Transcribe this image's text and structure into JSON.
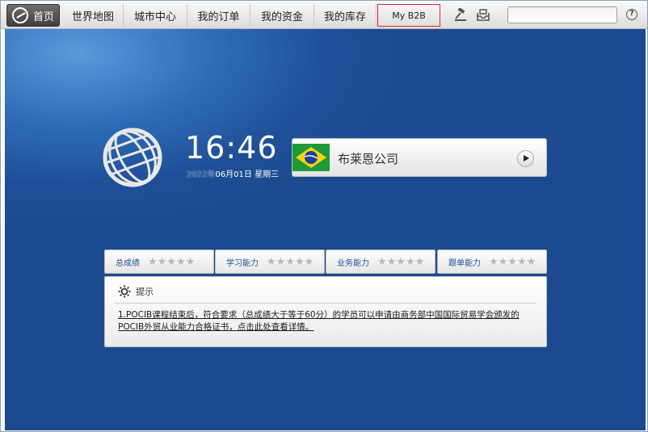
{
  "nav": {
    "home_label": "首页",
    "items": [
      {
        "label": "世界地图"
      },
      {
        "label": "城市中心"
      },
      {
        "label": "我的订单"
      },
      {
        "label": "我的资金"
      },
      {
        "label": "我的库存"
      },
      {
        "label": "My B2B"
      }
    ],
    "tools": [
      "gavel-icon",
      "inbox-icon"
    ],
    "help_label": "?"
  },
  "clock": {
    "time": "16:46",
    "date_blurred": "2022年",
    "date_rest": "06月01日 星期三"
  },
  "company": {
    "name": "布莱恩公司",
    "flag": "brazil-flag"
  },
  "stats": [
    {
      "label": "总成绩",
      "stars": "★★★★★"
    },
    {
      "label": "学习能力",
      "stars": "★★★★★"
    },
    {
      "label": "业务能力",
      "stars": "★★★★★"
    },
    {
      "label": "跟单能力",
      "stars": "★★★★★"
    }
  ],
  "tip": {
    "title": "提示",
    "text": "1.POCIB课程结束后，符合要求（总成绩大于等于60分）的学员可以申请由商务部中国国际贸易学会颁发的POCIB外贸从业能力合格证书，点击此处查看详情。"
  },
  "colors": {
    "accent_red": "#e0282d",
    "bg_blue": "#1e4f96"
  }
}
